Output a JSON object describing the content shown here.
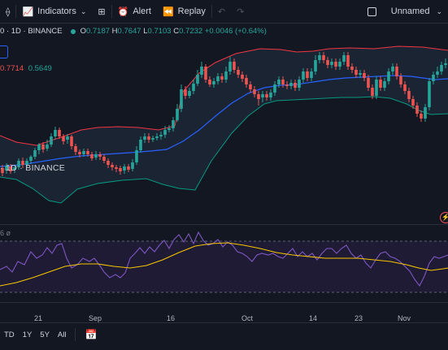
{
  "toolbar": {
    "indicators_label": "Indicators",
    "alert_label": "Alert",
    "replay_label": "Replay",
    "layout_name": "Unnamed"
  },
  "symbol": {
    "title": "· 1D · BINANCE",
    "title_prefix": "0",
    "open_label": "O",
    "open": "0.7187",
    "high_label": "H",
    "high": "0.7647",
    "low_label": "L",
    "low": "0.7103",
    "close_label": "C",
    "close": "0.7232",
    "change": "+0.0046 (+0.64%)"
  },
  "bollinger": {
    "upper": "0.7714",
    "lower": "0.5649"
  },
  "watermark": "· 1D · BINANCE",
  "rsi_legend": "6 ø",
  "xaxis": {
    "labels": [
      "21",
      "Sep",
      "16",
      "Oct",
      "14",
      "23",
      "Nov"
    ]
  },
  "ranges": [
    "TD",
    "1Y",
    "5Y",
    "All"
  ],
  "colors": {
    "up": "#26a69a",
    "down": "#ef5350",
    "basis": "#2962ff",
    "upper_band": "#f23645",
    "lower_band": "#089981",
    "rsi": "#7e57c2",
    "rsi_ma": "#f7c600"
  }
}
